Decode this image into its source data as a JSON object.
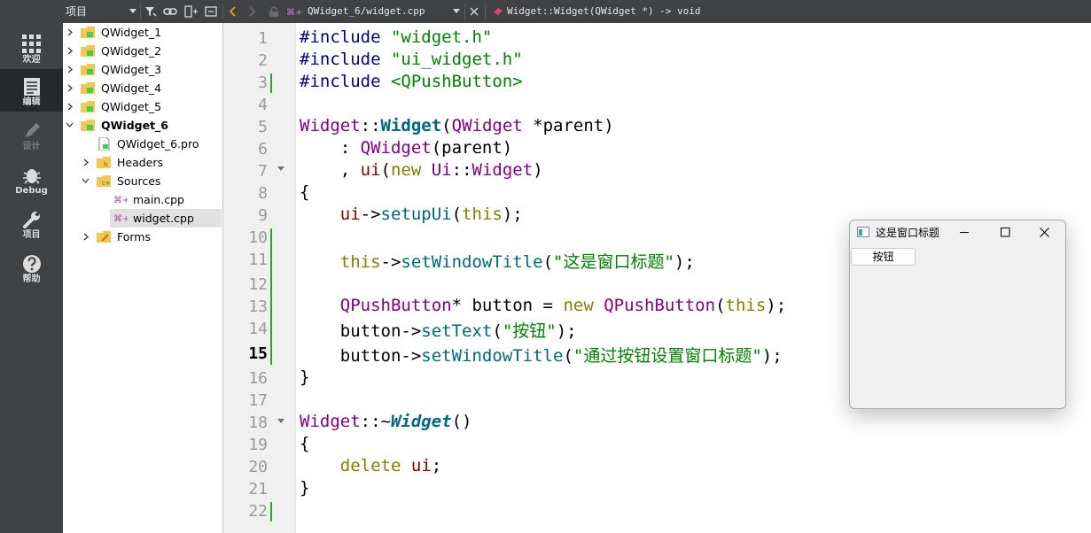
{
  "toolbar": {
    "pane_title": "项目",
    "file_path": "QWidget_6/widget.cpp",
    "symbol": "Widget::Widget(QWidget *) -> void"
  },
  "modes": [
    {
      "label": "欢迎",
      "icon": "grid-icon"
    },
    {
      "label": "编辑",
      "icon": "document-icon",
      "active": true
    },
    {
      "label": "设计",
      "icon": "pencil-icon",
      "disabled": true
    },
    {
      "label": "Debug",
      "icon": "bug-icon"
    },
    {
      "label": "项目",
      "icon": "wrench-icon"
    },
    {
      "label": "帮助",
      "icon": "help-icon"
    }
  ],
  "tree": [
    {
      "label": "QWidget_1"
    },
    {
      "label": "QWidget_2"
    },
    {
      "label": "QWidget_3"
    },
    {
      "label": "QWidget_4"
    },
    {
      "label": "QWidget_5"
    },
    {
      "label": "QWidget_6"
    },
    {
      "label": "QWidget_6.pro"
    },
    {
      "label": "Headers"
    },
    {
      "label": "Sources"
    },
    {
      "label": "main.cpp"
    },
    {
      "label": "widget.cpp",
      "selected": true
    },
    {
      "label": "Forms"
    }
  ],
  "editor": {
    "current_line": "15",
    "line_numbers": [
      "1",
      "2",
      "3",
      "4",
      "5",
      "6",
      "7",
      "8",
      "9",
      "10",
      "11",
      "12",
      "13",
      "14",
      "15",
      "16",
      "17",
      "18",
      "19",
      "20",
      "21",
      "22"
    ],
    "code": {
      "l1_pp": "#include ",
      "l1_str": "\"widget.h\"",
      "l2_pp": "#include ",
      "l2_str": "\"ui_widget.h\"",
      "l3_pp": "#include ",
      "l3_str": "<QPushButton>",
      "l5_ty": "Widget",
      "l5_op": "::",
      "l5_fn": "Widget",
      "l5_p": "(",
      "l5_ty2": "QWidget",
      "l5_rest": " *parent)",
      "l6_a": "    : ",
      "l6_ty": "QWidget",
      "l6_rest": "(parent)",
      "l7_a": "    , ",
      "l7_mem": "ui",
      "l7_b": "(",
      "l7_kw": "new",
      "l7_c": " ",
      "l7_ty": "Ui",
      "l7_d": "::",
      "l7_ty2": "Widget",
      "l7_e": ")",
      "l8": "{",
      "l9_a": "    ",
      "l9_mem": "ui",
      "l9_b": "->",
      "l9_fn": "setupUi",
      "l9_c": "(",
      "l9_kw": "this",
      "l9_d": ");",
      "l11_a": "    ",
      "l11_kw": "this",
      "l11_b": "->",
      "l11_fn": "setWindowTitle",
      "l11_c": "(",
      "l11_str": "\"这是窗口标题\"",
      "l11_d": ");",
      "l13_a": "    ",
      "l13_ty": "QPushButton",
      "l13_b": "* button = ",
      "l13_kw": "new",
      "l13_c": " ",
      "l13_ty2": "QPushButton",
      "l13_d": "(",
      "l13_kw2": "this",
      "l13_e": ");",
      "l14_a": "    button->",
      "l14_fn": "setText",
      "l14_b": "(",
      "l14_str": "\"按钮\"",
      "l14_c": ");",
      "l15_a": "    button->",
      "l15_fn": "setWindowTitle",
      "l15_b": "(",
      "l15_str": "\"通过按钮设置窗口标题\"",
      "l15_c": ");",
      "l16": "}",
      "l18_ty": "Widget",
      "l18_op": "::~",
      "l18_fn": "Widget",
      "l18_rest": "()",
      "l19": "{",
      "l20_a": "    ",
      "l20_kw": "delete",
      "l20_b": " ",
      "l20_mem": "ui",
      "l20_c": ";",
      "l21": "}"
    }
  },
  "floating_window": {
    "title": "这是窗口标题",
    "button_label": "按钮"
  }
}
